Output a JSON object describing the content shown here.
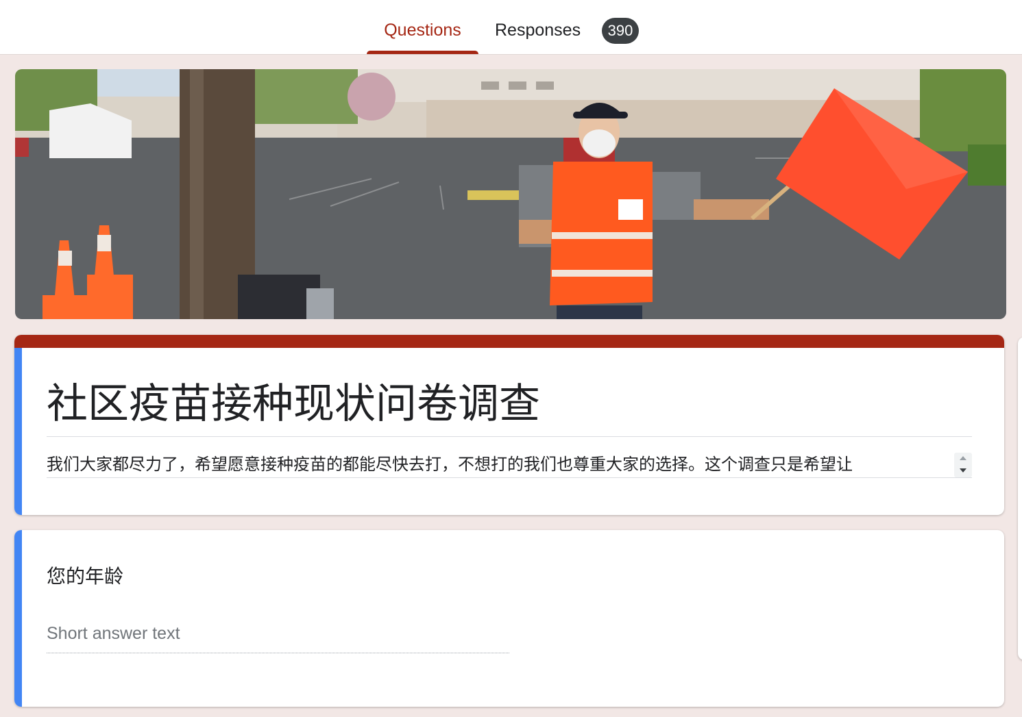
{
  "tabs": {
    "questions_label": "Questions",
    "responses_label": "Responses",
    "responses_count": "390"
  },
  "form": {
    "title": "社区疫苗接种现状问卷调查",
    "description": "我们大家都尽力了，希望愿意接种疫苗的都能尽快去打，不想打的我们也尊重大家的选择。这个调查只是希望让"
  },
  "questions": [
    {
      "title": "您的年龄",
      "placeholder": "Short answer text"
    }
  ],
  "colors": {
    "theme": "#a52714",
    "background": "#f2e7e5",
    "focus_strip": "#4285f4"
  }
}
